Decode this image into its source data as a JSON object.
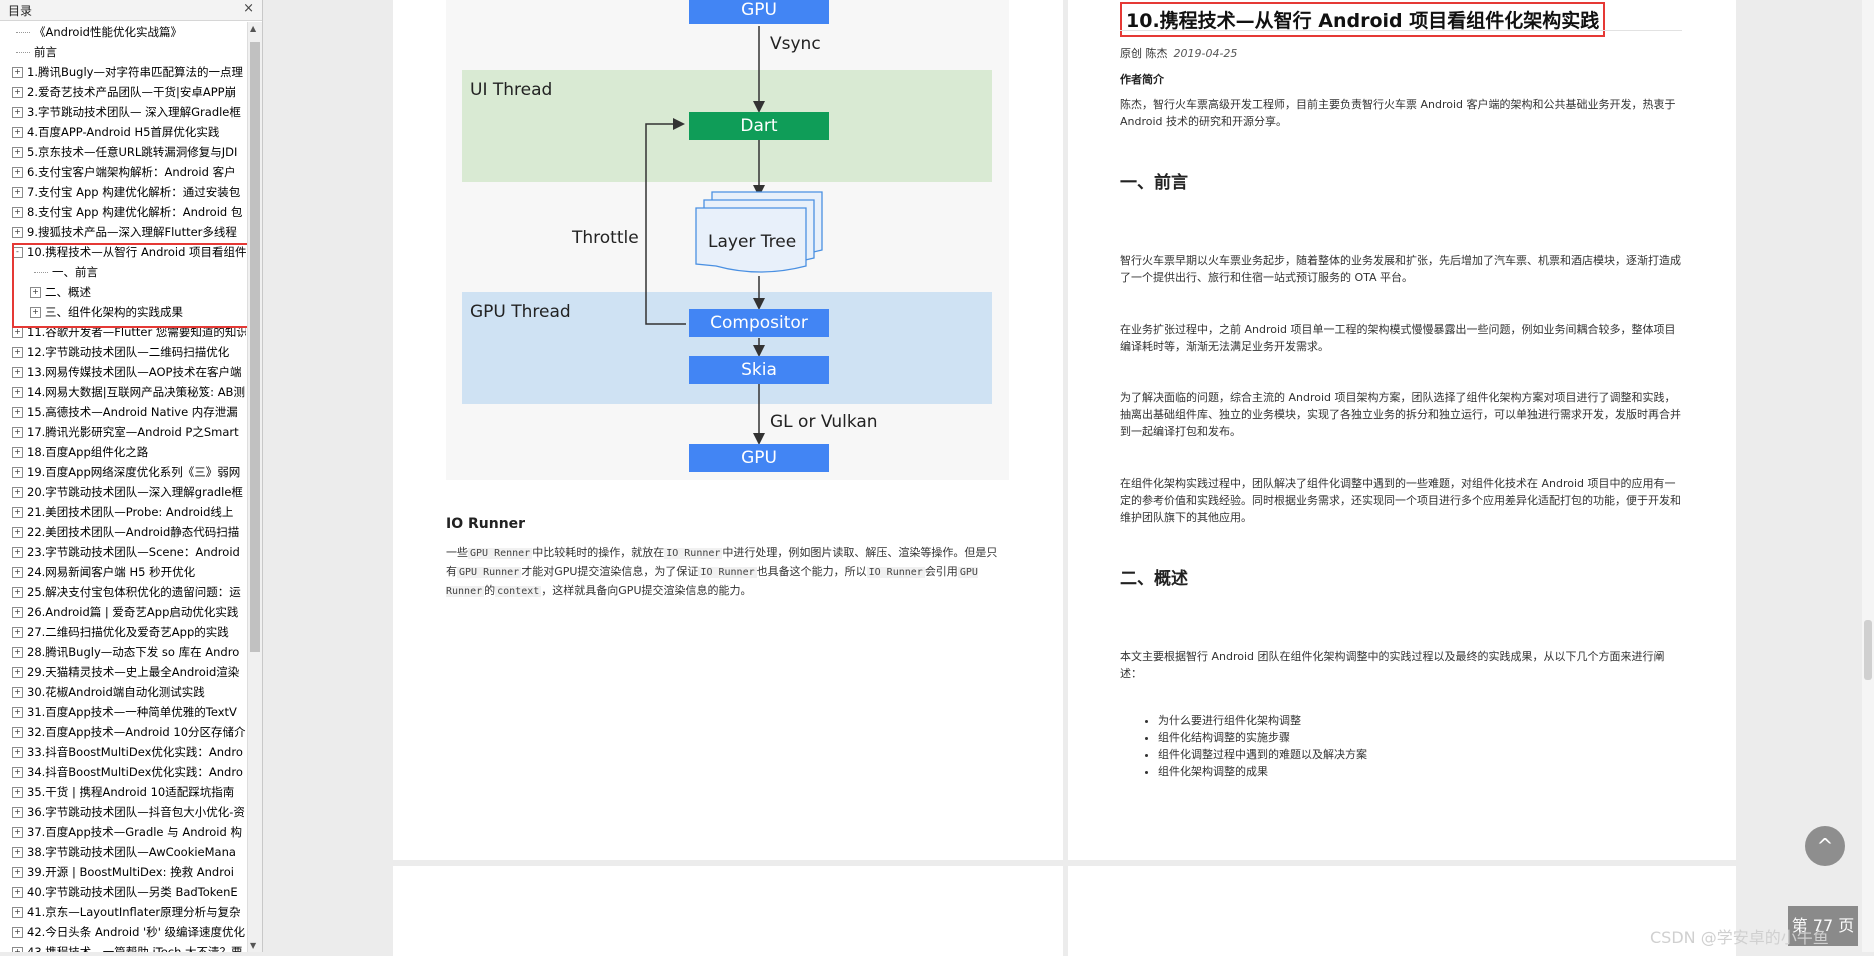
{
  "sidebar": {
    "title": "目录",
    "close_icon": "×",
    "items": [
      {
        "label": "《Android性能优化实战篇》",
        "expand": ""
      },
      {
        "label": "前言",
        "expand": ""
      },
      {
        "label": "1.腾讯Bugly—对字符串匹配算法的一点理",
        "expand": "+"
      },
      {
        "label": "2.爱奇艺技术产品团队—干货|安卓APP崩",
        "expand": "+"
      },
      {
        "label": "3.字节跳动技术团队— 深入理解Gradle框",
        "expand": "+"
      },
      {
        "label": "4.百度APP-Android H5首屏优化实践",
        "expand": "+"
      },
      {
        "label": "5.京东技术—任意URL跳转漏洞修复与JDI",
        "expand": "+"
      },
      {
        "label": "6.支付宝客户端架构解析：Android 客户",
        "expand": "+"
      },
      {
        "label": "7.支付宝 App 构建优化解析：通过安装包",
        "expand": "+"
      },
      {
        "label": "8.支付宝 App 构建优化解析：Android 包",
        "expand": "+"
      },
      {
        "label": "9.搜狐技术产品—深入理解Flutter多线程",
        "expand": "+"
      },
      {
        "label": "10.携程技术—从智行 Android 项目看组件",
        "expand": "-"
      },
      {
        "label": "一、前言",
        "expand": "",
        "sub": true
      },
      {
        "label": "二、概述",
        "expand": "+",
        "sub": true
      },
      {
        "label": "三、组件化架构的实践成果",
        "expand": "+",
        "sub": true
      },
      {
        "label": "11.谷歌开发者—Flutter 您需要知道的知识",
        "expand": "+"
      },
      {
        "label": "12.字节跳动技术团队—二维码扫描优化",
        "expand": "+"
      },
      {
        "label": "13.网易传媒技术团队—AOP技术在客户端",
        "expand": "+"
      },
      {
        "label": "14.网易大数据|互联网产品决策秘笈: AB测",
        "expand": "+"
      },
      {
        "label": "15.高德技术—Android Native 内存泄漏",
        "expand": "+"
      },
      {
        "label": "17.腾讯光影研究室—Android P之Smart",
        "expand": "+"
      },
      {
        "label": "18.百度App组件化之路",
        "expand": "+"
      },
      {
        "label": "19.百度App网络深度优化系列《三》弱网",
        "expand": "+"
      },
      {
        "label": "20.字节跳动技术团队—深入理解gradle框",
        "expand": "+"
      },
      {
        "label": "21.美团技术团队—Probe: Android线上",
        "expand": "+"
      },
      {
        "label": "22.美团技术团队—Android静态代码扫描",
        "expand": "+"
      },
      {
        "label": "23.字节跳动技术团队—Scene：Android",
        "expand": "+"
      },
      {
        "label": "24.网易新闻客户端 H5 秒开优化",
        "expand": "+"
      },
      {
        "label": "25.解决支付宝包体积优化的遗留问题：运",
        "expand": "+"
      },
      {
        "label": "26.Android篇 | 爱奇艺App启动优化实践",
        "expand": "+"
      },
      {
        "label": "27.二维码扫描优化及爱奇艺App的实践",
        "expand": "+"
      },
      {
        "label": "28.腾讯Bugly—动态下发 so 库在 Andro",
        "expand": "+"
      },
      {
        "label": "29.天猫精灵技术—史上最全Android渲染",
        "expand": "+"
      },
      {
        "label": "30.花椒Android端自动化测试实践",
        "expand": "+"
      },
      {
        "label": "31.百度App技术—一种简单优雅的TextV",
        "expand": "+"
      },
      {
        "label": "32.百度App技术—Android 10分区存储介",
        "expand": "+"
      },
      {
        "label": "33.抖音BoostMultiDex优化实践：Andro",
        "expand": "+"
      },
      {
        "label": "34.抖音BoostMultiDex优化实践：Andro",
        "expand": "+"
      },
      {
        "label": "35.干货 | 携程Android 10适配踩坑指南",
        "expand": "+"
      },
      {
        "label": "36.字节跳动技术团队—抖音包大小优化-资",
        "expand": "+"
      },
      {
        "label": "37.百度App技术—Gradle 与 Android 构",
        "expand": "+"
      },
      {
        "label": "38.字节跳动技术团队—AwCookieMana",
        "expand": "+"
      },
      {
        "label": "39.开源 | BoostMultiDex: 挽救 Androi",
        "expand": "+"
      },
      {
        "label": "40.字节跳动技术团队—另类 BadTokenE",
        "expand": "+"
      },
      {
        "label": "41.京东—LayoutInflater原理分析与复杂",
        "expand": "+"
      },
      {
        "label": "42.今日头条 Android '秒' 级编译速度优化",
        "expand": "+"
      },
      {
        "label": "43.携程技术—一篇帮助 iTech 大不清？要",
        "expand": "+"
      }
    ]
  },
  "diagram": {
    "top_node": "GPU",
    "vsync": "Vsync",
    "ui_thread": "UI Thread",
    "dart": "Dart",
    "layer_tree": "Layer Tree",
    "throttle": "Throttle",
    "gpu_thread": "GPU Thread",
    "compositor": "Compositor",
    "skia": "Skia",
    "gl": "GL or Vulkan",
    "bottom_node": "GPU",
    "colors": {
      "blue_node": "#4285f4",
      "green_node": "#0f9d58",
      "ui_band": "#d9ead3",
      "gpu_band": "#cfe2f3"
    }
  },
  "left_text": {
    "io_title": "IO Runner",
    "p1a": "一些",
    "code1": "GPU Renner",
    "p1b": "中比较耗时的操作，就放在",
    "code2": "IO Runner",
    "p1c": "中进行处理，例如图片读取、解压、渲染等操作。但是只有",
    "code3": "GPU Runner",
    "p1d": "才能对GPU提交渲染信息，为了保证",
    "code4": "IO Runner",
    "p1e": "也具备这个能力，所以",
    "code5": "IO Runner",
    "p1f": "会引用",
    "code6": "GPU Runner",
    "p1g": "的",
    "code7": "context",
    "p1h": "，这样就具备向GPU提交渲染信息的能力。"
  },
  "article": {
    "title": "10.携程技术—从智行 Android 项目看组件化架构实践",
    "meta_prefix": "原创 陈杰",
    "date": "2019-04-25",
    "author_heading": "作者简介",
    "author_bio": "陈杰，智行火车票高级开发工程师，目前主要负责智行火车票 Android 客户端的架构和公共基础业务开发，热衷于 Android 技术的研究和开源分享。",
    "h_preface": "一、前言",
    "p1": "智行火车票早期以火车票业务起步，随着整体的业务发展和扩张，先后增加了汽车票、机票和酒店模块，逐渐打造成了一个提供出行、旅行和住宿一站式预订服务的 OTA 平台。",
    "p2": "在业务扩张过程中，之前 Android 项目单一工程的架构模式慢慢暴露出一些问题，例如业务间耦合较多，整体项目编译耗时等，渐渐无法满足业务开发需求。",
    "p3": "为了解决面临的问题，综合主流的 Android 项目架构方案，团队选择了组件化架构方案对项目进行了调整和实践，抽离出基础组件库、独立的业务模块，实现了各独立业务的拆分和独立运行，可以单独进行需求开发，发版时再合并到一起编译打包和发布。",
    "p4": "在组件化架构实践过程中，团队解决了组件化调整中遇到的一些难题，对组件化技术在 Android 项目中的应用有一定的参考价值和实践经验。同时根据业务需求，还实现同一个项目进行多个应用差异化适配打包的功能，便于开发和维护团队旗下的其他应用。",
    "h_overview": "二、概述",
    "p5": "本文主要根据智行 Android 团队在组件化架构调整中的实践过程以及最终的实践成果，从以下几个方面来进行阐述：",
    "bullets": [
      "为什么要进行组件化架构调整",
      "组件化结构调整的实施步骤",
      "组件化调整过程中遇到的难题以及解决方案",
      "组件化架构调整的成果"
    ]
  },
  "overlay": {
    "to_top_icon": "^",
    "page_badge": "第 77 页",
    "watermark": "CSDN @学安卓的小牛鱼"
  }
}
